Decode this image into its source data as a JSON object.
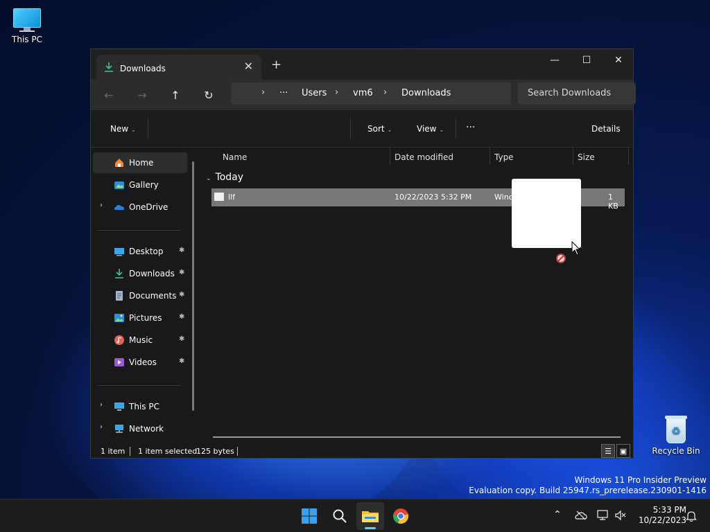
{
  "desktop": {
    "icons": [
      {
        "label": "This PC"
      },
      {
        "label": "Recycle Bin"
      }
    ],
    "watermark": {
      "line1": "Windows 11 Pro Insider Preview",
      "line2": "Evaluation copy. Build 25947.rs_prerelease.230901-1416"
    }
  },
  "explorer": {
    "tab": {
      "title": "Downloads",
      "close": "✕"
    },
    "newtab": "+",
    "controls": {
      "minimize": "—",
      "maximize": "☐",
      "close": "✕"
    },
    "nav": {
      "back": "←",
      "forward": "→",
      "up": "↑",
      "refresh": "↻"
    },
    "address": {
      "overflow": "···",
      "crumbs": [
        "Users",
        "vm6",
        "Downloads"
      ],
      "separator": "›"
    },
    "search_placeholder": "Search Downloads",
    "commands": {
      "new": "New",
      "sort": "Sort",
      "view": "View",
      "more": "···",
      "details": "Details",
      "caret": "⌄"
    },
    "sidebar": {
      "items": [
        {
          "label": "Home",
          "icon": "home-icon",
          "selected": true
        },
        {
          "label": "Gallery",
          "icon": "gallery-icon"
        },
        {
          "label": "OneDrive",
          "icon": "cloud-icon",
          "expandable": true
        }
      ],
      "quick_access": [
        {
          "label": "Desktop",
          "icon": "desktop-icon",
          "pinned": true
        },
        {
          "label": "Downloads",
          "icon": "download-icon",
          "pinned": true
        },
        {
          "label": "Documents",
          "icon": "document-icon",
          "pinned": true
        },
        {
          "label": "Pictures",
          "icon": "pictures-icon",
          "pinned": true
        },
        {
          "label": "Music",
          "icon": "music-icon",
          "pinned": true
        },
        {
          "label": "Videos",
          "icon": "video-icon",
          "pinned": true
        }
      ],
      "locations": [
        {
          "label": "This PC",
          "icon": "computer-icon",
          "expandable": true
        },
        {
          "label": "Network",
          "icon": "network-icon",
          "expandable": true
        }
      ],
      "pin_glyph": "📌",
      "expand_glyph": "›"
    },
    "columns": [
      "Name",
      "Date modified",
      "Type",
      "Size"
    ],
    "group": {
      "label": "Today",
      "chevron": "⌄"
    },
    "files": [
      {
        "name": "llf",
        "date_modified": "10/22/2023 5:32 PM",
        "type": "Winc",
        "size": "1 KB",
        "selected": true
      }
    ],
    "status": {
      "count": "1 item",
      "selected": "1 item selected",
      "bytes": "125 bytes"
    },
    "view_buttons": {
      "details": "☰",
      "tiles": "▣"
    }
  },
  "taskbar": {
    "tray": {
      "chevron": "⌃"
    },
    "clock": {
      "time": "5:33 PM",
      "date": "10/22/2023"
    }
  },
  "colors": {
    "accent": "#60cdff",
    "window_bg": "#191919",
    "selection": "#777777"
  }
}
